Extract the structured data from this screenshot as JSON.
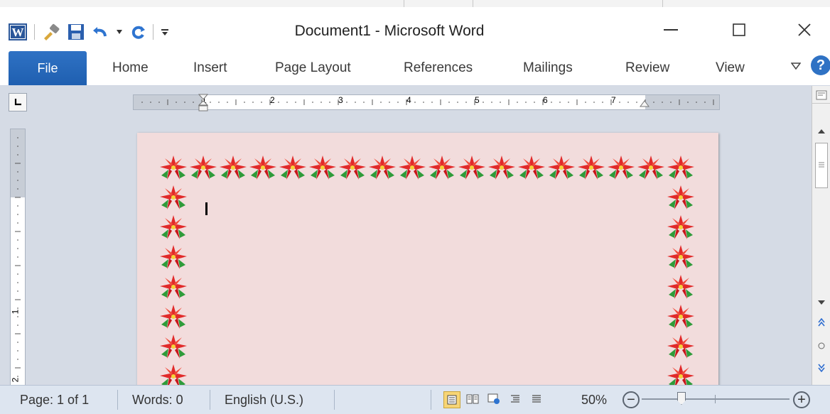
{
  "window": {
    "title": "Document1 - Microsoft Word",
    "app_logo": "W",
    "controls": [
      "minimize-icon",
      "maximize-icon",
      "close-icon"
    ]
  },
  "quick_access": {
    "icons": [
      "word-logo-icon",
      "format-painter-icon",
      "save-icon",
      "undo-icon",
      "undo-dropdown-icon",
      "redo-icon",
      "customize-toolbar-icon"
    ]
  },
  "ribbon": {
    "tabs": [
      {
        "label": "File"
      },
      {
        "label": "Home"
      },
      {
        "label": "Insert"
      },
      {
        "label": "Page Layout"
      },
      {
        "label": "References"
      },
      {
        "label": "Mailings"
      },
      {
        "label": "Review"
      },
      {
        "label": "View"
      }
    ],
    "help_label": "?"
  },
  "ruler": {
    "horizontal_numbers": [
      "1",
      "2",
      "3",
      "4",
      "5",
      "6",
      "7"
    ],
    "vertical_numbers": [
      "1",
      "2"
    ]
  },
  "document": {
    "page_color": "#f2dcdc",
    "border_style": "poinsettia-art-border"
  },
  "status": {
    "page": "Page: 1 of 1",
    "words": "Words: 0",
    "language": "English (U.S.)",
    "zoom": "50%",
    "zoom_level_fraction": 0.25,
    "zoom_minus": "−",
    "zoom_plus": "+"
  }
}
